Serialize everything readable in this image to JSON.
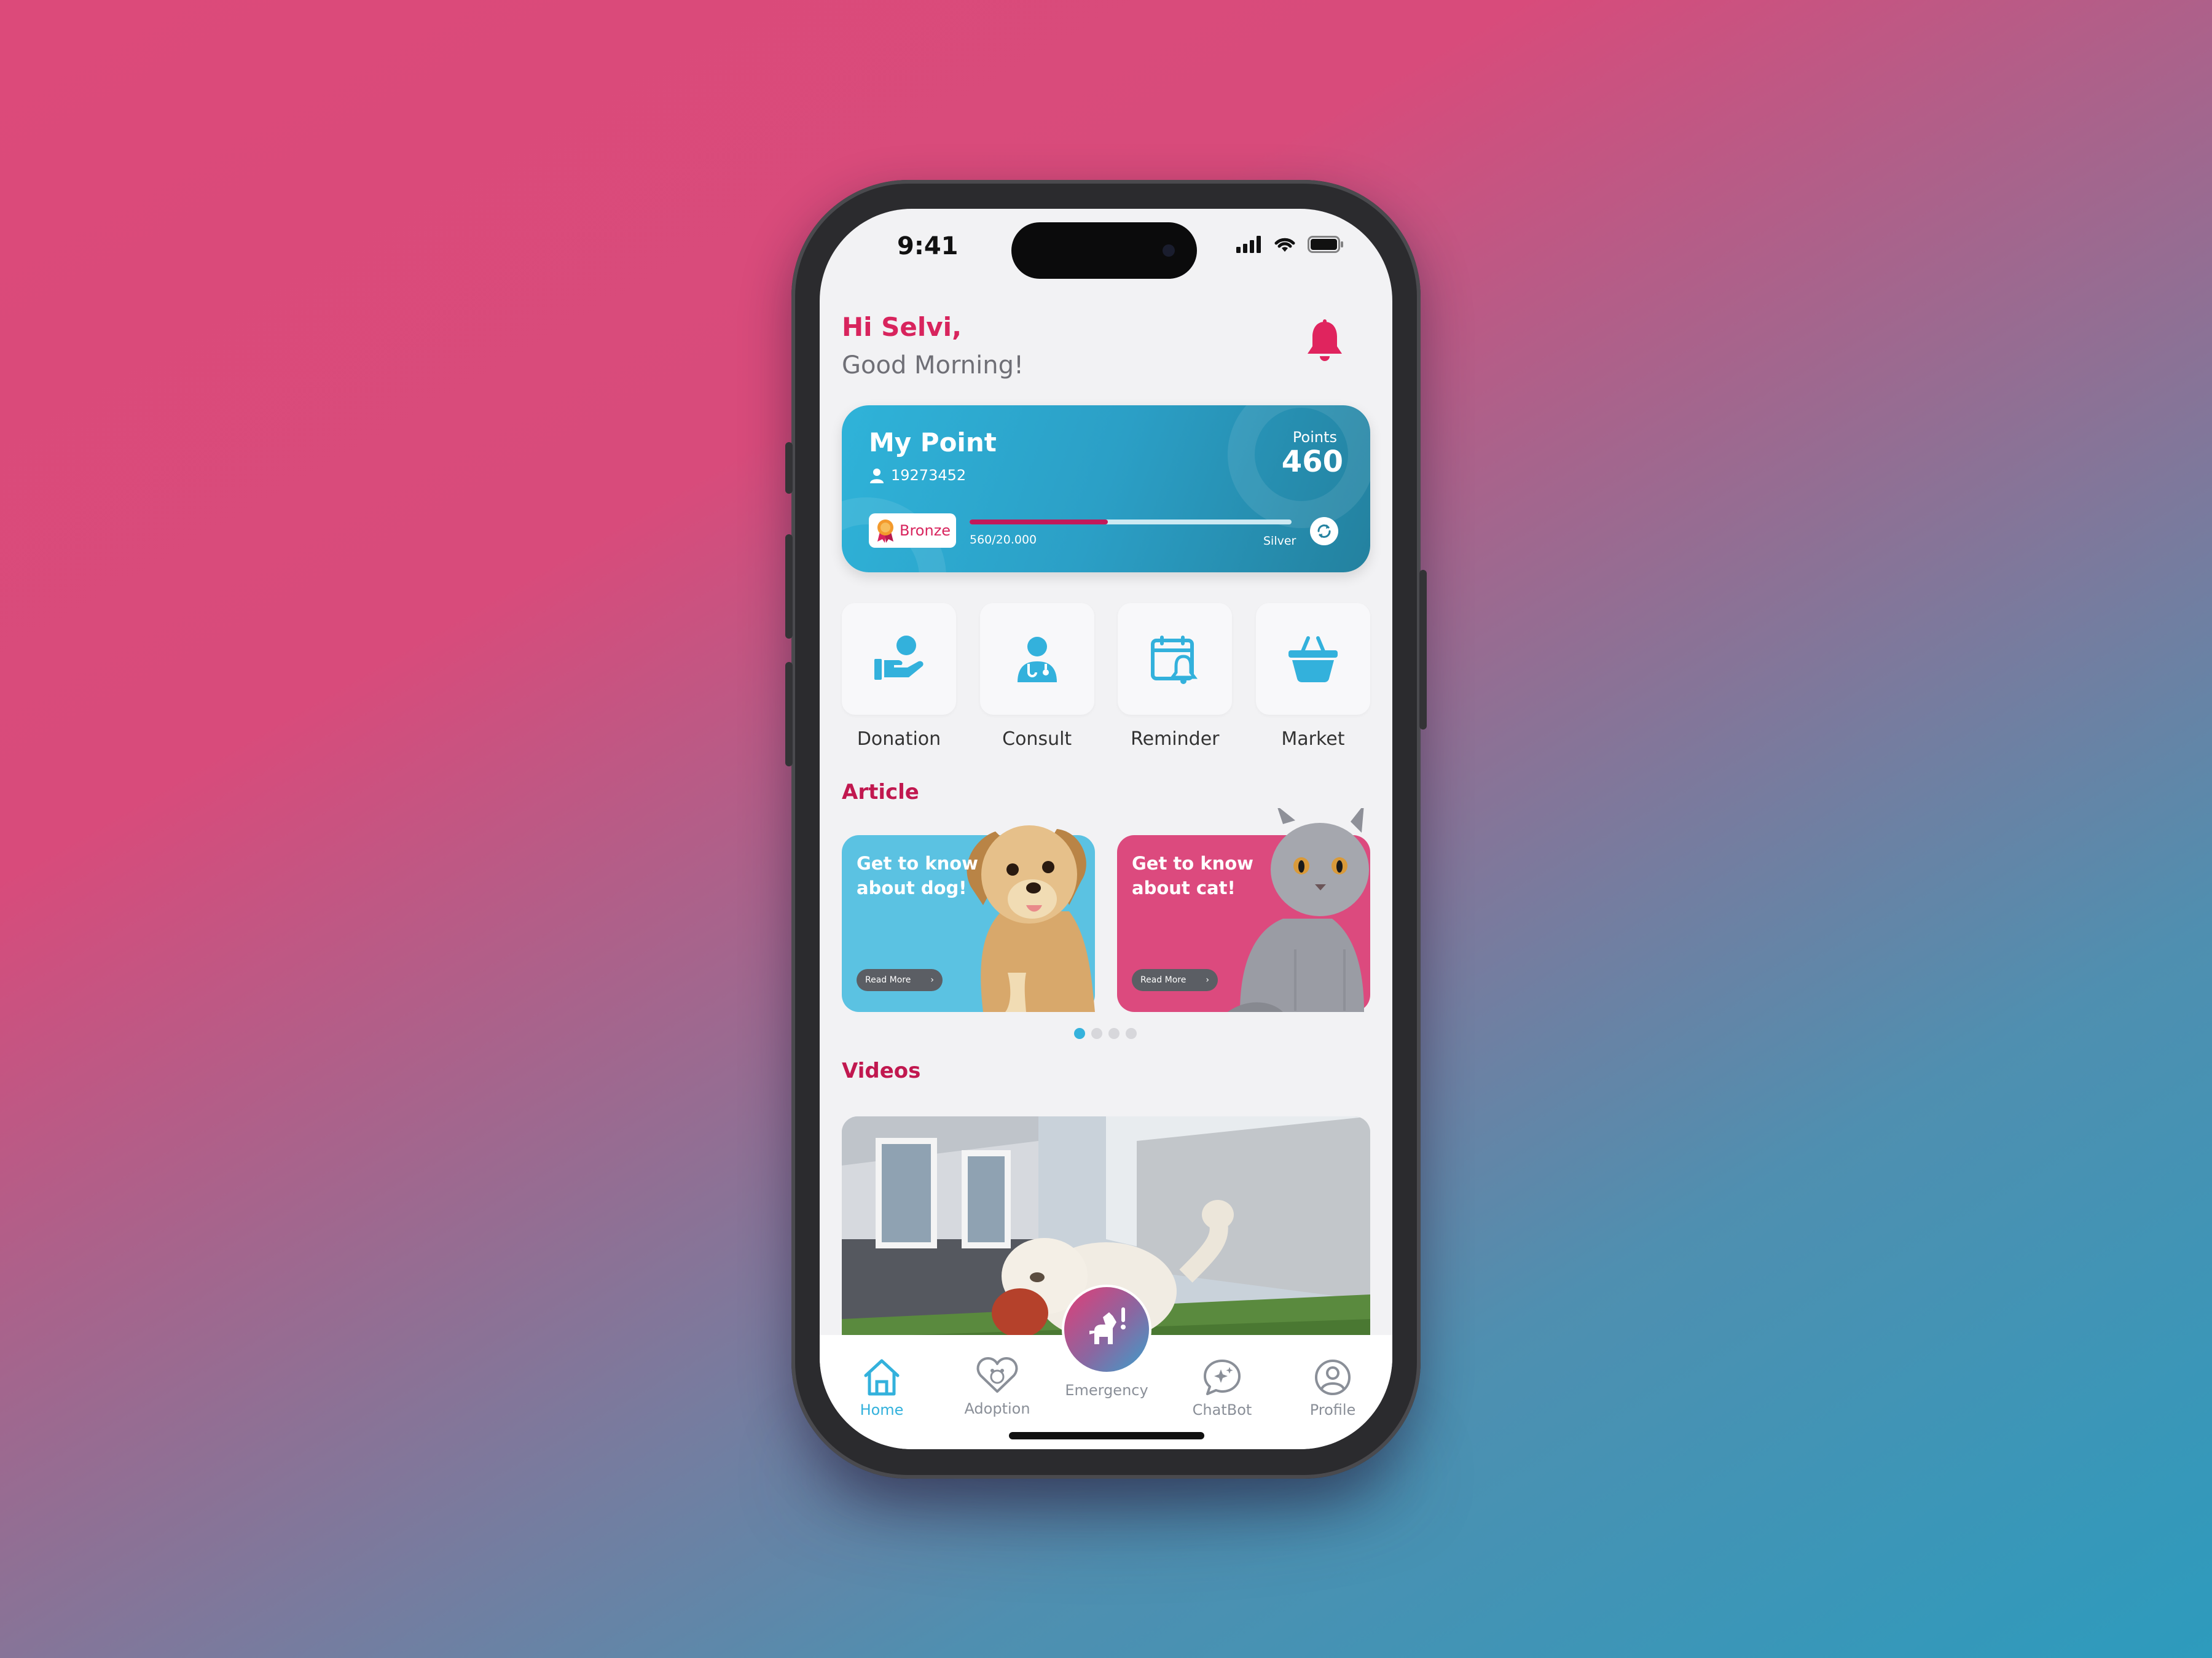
{
  "status_bar": {
    "time": "9:41"
  },
  "header": {
    "greeting": "Hi Selvi,",
    "subtitle": "Good Morning!"
  },
  "point_card": {
    "title": "My Point",
    "member_id": "19273452",
    "points_label": "Points",
    "points_value": "460",
    "tier": "Bronze",
    "progress_text": "560/20.000",
    "next_tier": "Silver",
    "progress_fraction": 0.43
  },
  "menu": [
    {
      "label": "Donation",
      "icon": "donation-hand-icon"
    },
    {
      "label": "Consult",
      "icon": "doctor-icon"
    },
    {
      "label": "Reminder",
      "icon": "calendar-bell-icon"
    },
    {
      "label": "Market",
      "icon": "basket-icon"
    }
  ],
  "articles": {
    "title": "Article",
    "items": [
      {
        "text": "Get to know about dog!",
        "button": "Read More",
        "color": "#5bc2e2"
      },
      {
        "text": "Get to know about cat!",
        "button": "Read More",
        "color": "#dc4a7e"
      }
    ],
    "page_count": 4,
    "active_page": 0
  },
  "videos": {
    "title": "Videos"
  },
  "tabbar": {
    "home": "Home",
    "adoption": "Adoption",
    "emergency": "Emergency",
    "chatbot": "ChatBot",
    "profile": "Profile"
  },
  "colors": {
    "accent_pink": "#d8245d",
    "accent_blue": "#33b1dc",
    "card_gradient_start": "#2fb3d9",
    "card_gradient_end": "#23819f"
  }
}
